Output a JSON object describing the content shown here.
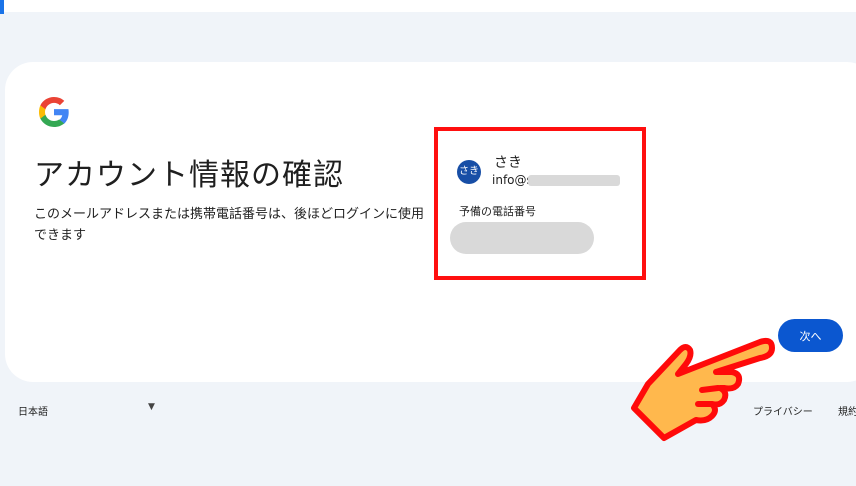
{
  "signin": {
    "logo_icon": "google-g-icon",
    "title": "アカウント情報の確認",
    "description": "このメールアドレスまたは携帯電話番号は、後ほどログインに使用できます"
  },
  "account": {
    "avatar_text": "さき",
    "name": "さき",
    "email_visible": "info@s"
  },
  "phone": {
    "label": "予備の電話番号"
  },
  "buttons": {
    "next": "次へ"
  },
  "footer": {
    "language": "日本語",
    "privacy": "プライバシー",
    "terms": "規約"
  },
  "colors": {
    "background": "#f0f4f9",
    "card": "#ffffff",
    "primary_button": "#0b57d0",
    "highlight_border": "#ff0f0f",
    "avatar": "#174ea6",
    "hand_fill": "#ffb84d"
  }
}
